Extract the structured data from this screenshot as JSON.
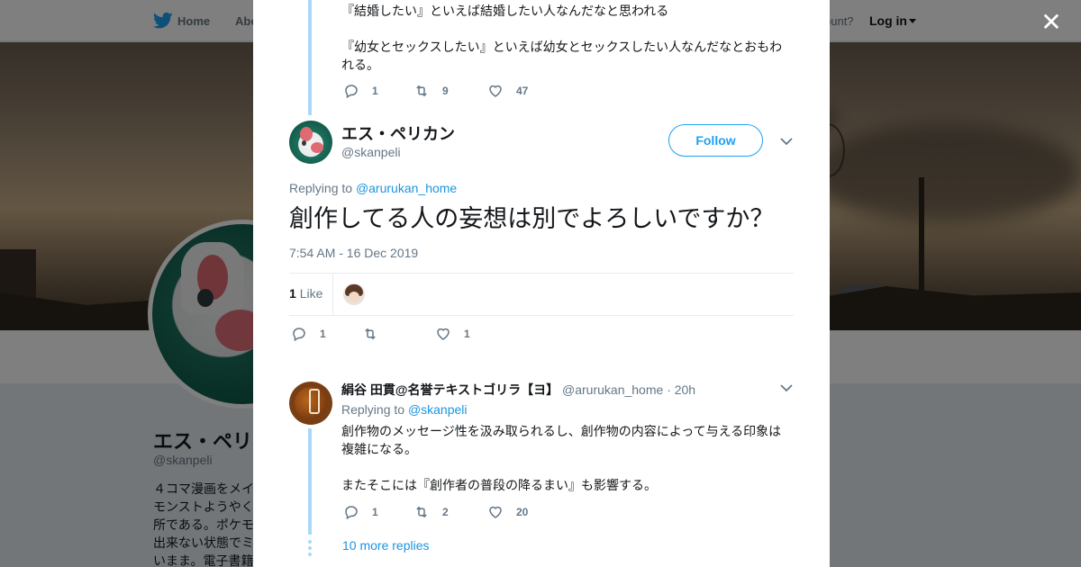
{
  "topnav": {
    "home_label": "Home",
    "about_label": "Abo",
    "account_text": "ccount?",
    "login_label": "Log in"
  },
  "profile": {
    "name": "エス・ペリ",
    "handle": "@skanpeli",
    "bio_lines": [
      "４コマ漫画をメイ",
      "モンストようやく",
      "所である。ポケモ",
      "出来ない状態でミ",
      "いまま。電子書籍"
    ]
  },
  "modal": {
    "close_icon": "close-icon",
    "parent_tweet": {
      "text_lines": [
        "『結婚したい』といえば結婚したい人なんだなと思われる",
        "",
        "『幼女とセックスしたい』といえば幼女とセックスしたい人なんだなとおもわ",
        "れる。"
      ],
      "replies": "1",
      "retweets": "9",
      "likes": "47"
    },
    "main_tweet": {
      "name": "エス・ペリカン",
      "handle": "@skanpeli",
      "follow_label": "Follow",
      "replying_prefix": "Replying to",
      "replying_to": "@arurukan_home",
      "text": "創作してる人の妄想は別でよろしいですか？",
      "timestamp": "7:54 AM - 16 Dec 2019",
      "like_count": "1",
      "like_label": "Like",
      "replies": "1",
      "likes": "1"
    },
    "reply_tweet": {
      "name": "絹谷 田貫@名誉テキストゴリラ【ヨ】",
      "handle": "@arurukan_home",
      "age": "· 20h",
      "replying_prefix": "Replying to",
      "replying_to": "@skanpeli",
      "text_lines": [
        "創作物のメッセージ性を汲み取られるし、創作物の内容によって与える印象は",
        "複雑になる。",
        "",
        "またそこには『創作者の普段の降るまい』も影響する。"
      ],
      "replies": "1",
      "retweets": "2",
      "likes": "20"
    },
    "more_replies": "10 more replies"
  },
  "colors": {
    "brand_blue": "#1da1f2",
    "link_blue": "#1b95e0",
    "thread_line": "#a8daf8",
    "muted_text": "#657786"
  }
}
